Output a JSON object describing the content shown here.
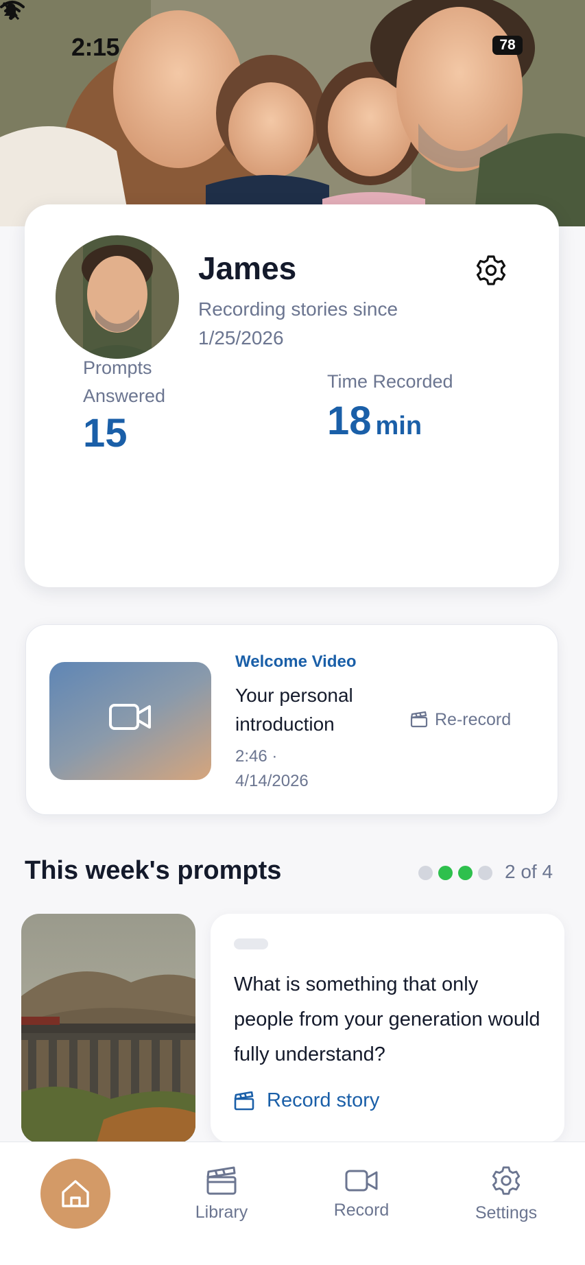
{
  "status_bar": {
    "time": "2:15",
    "battery": "78"
  },
  "hero": {
    "image": "family-photo"
  },
  "profile": {
    "name": "James",
    "since": "Recording stories since 1/25/2026",
    "settings_icon": "gear-icon",
    "stats": {
      "prompts_label": "Prompts Answered",
      "prompts_value": "15",
      "time_label": "Time Recorded",
      "time_value": "18",
      "time_unit": "min"
    }
  },
  "welcome_video": {
    "kicker": "Welcome Video",
    "title": "Your personal introduction",
    "meta": "2:46 · 4/14/2026",
    "rerecord_label": "Re-record",
    "thumb_icon": "video-camera-icon"
  },
  "prompts": {
    "section_title": "This week's prompts",
    "page_indicator": "2 of 4",
    "dots_total": 4,
    "dots_active": [
      1,
      2
    ],
    "current": {
      "text": "What is something that only people from your generation would fully understand?",
      "record_label": "Record story",
      "image": "viaduct-train-landscape"
    }
  },
  "tabbar": {
    "items": [
      {
        "label": "",
        "icon": "home-icon",
        "active": true
      },
      {
        "label": "Library",
        "icon": "clapperboard-icon",
        "active": false
      },
      {
        "label": "Record",
        "icon": "video-camera-icon",
        "active": false
      },
      {
        "label": "Settings",
        "icon": "gear-icon",
        "active": false
      }
    ]
  },
  "colors": {
    "accent": "#1a5fa8",
    "home_active": "#d39a67",
    "dot_active": "#2ec04d",
    "muted_text": "#6b7590"
  }
}
